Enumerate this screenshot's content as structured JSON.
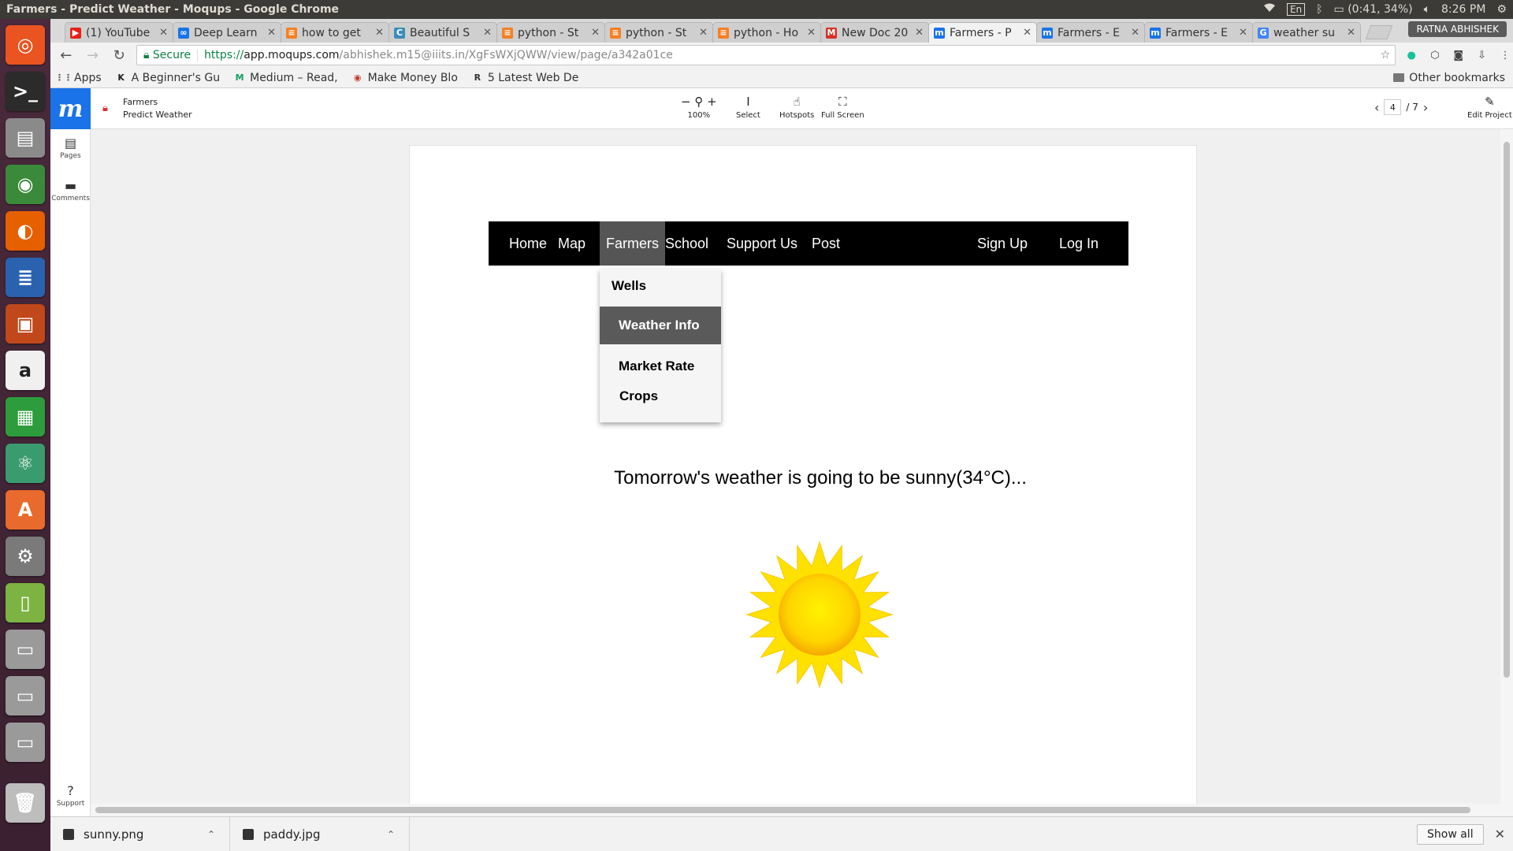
{
  "system_panel": {
    "window_title": "Farmers - Predict Weather - Moqups - Google Chrome",
    "keyboard": "En",
    "battery": "(0:41, 34%)",
    "clock": "8:26 PM"
  },
  "launcher": {
    "apps": [
      {
        "name": "ubuntu-dash-icon",
        "glyph": "◎",
        "color": "#e95420"
      },
      {
        "name": "terminal-icon",
        "glyph": ">_",
        "color": "#2b2b2b"
      },
      {
        "name": "file-manager-icon",
        "glyph": "▤",
        "color": "#8a8a8a"
      },
      {
        "name": "chrome-icon",
        "glyph": "◉",
        "color": "#3b8a3b"
      },
      {
        "name": "firefox-icon",
        "glyph": "◐",
        "color": "#e66000"
      },
      {
        "name": "writer-icon",
        "glyph": "≣",
        "color": "#2a62b0"
      },
      {
        "name": "impress-icon",
        "glyph": "▣",
        "color": "#c0481b"
      },
      {
        "name": "amazon-icon",
        "glyph": "a",
        "color": "#f0f0f0"
      },
      {
        "name": "calc-icon",
        "glyph": "▦",
        "color": "#2d9c3c"
      },
      {
        "name": "atom-icon",
        "glyph": "⚛",
        "color": "#3a9b6e"
      },
      {
        "name": "software-center-icon",
        "glyph": "A",
        "color": "#e86a2c"
      },
      {
        "name": "system-settings-icon",
        "glyph": "⚙",
        "color": "#7a7a7a"
      },
      {
        "name": "android-icon",
        "glyph": "▯",
        "color": "#7cb342"
      },
      {
        "name": "drive-1-icon",
        "glyph": "▭",
        "color": "#9a9a9a"
      },
      {
        "name": "drive-2-icon",
        "glyph": "▭",
        "color": "#9a9a9a"
      },
      {
        "name": "drive-3-icon",
        "glyph": "▭",
        "color": "#9a9a9a"
      },
      {
        "name": "trash-icon",
        "glyph": "🗑",
        "color": "#bdbdbd"
      }
    ]
  },
  "browser": {
    "tabs": [
      {
        "title": "(1) YouTube",
        "fav": "▶",
        "fav_color": "#e62117",
        "active": false
      },
      {
        "title": "Deep Learn",
        "fav": "∞",
        "fav_color": "#1a73e8",
        "active": false
      },
      {
        "title": "how to get",
        "fav": "≡",
        "fav_color": "#f48024",
        "active": false
      },
      {
        "title": "Beautiful S",
        "fav": "C",
        "fav_color": "#3c8dbc",
        "active": false
      },
      {
        "title": "python - St",
        "fav": "≡",
        "fav_color": "#f48024",
        "active": false
      },
      {
        "title": "python - St",
        "fav": "≡",
        "fav_color": "#f48024",
        "active": false
      },
      {
        "title": "python - Ho",
        "fav": "≡",
        "fav_color": "#f48024",
        "active": false
      },
      {
        "title": "New Doc 20",
        "fav": "M",
        "fav_color": "#d93025",
        "active": false
      },
      {
        "title": "Farmers - P",
        "fav": "m",
        "fav_color": "#1a73e8",
        "active": true
      },
      {
        "title": "Farmers - E",
        "fav": "m",
        "fav_color": "#1a73e8",
        "active": false
      },
      {
        "title": "Farmers - E",
        "fav": "m",
        "fav_color": "#1a73e8",
        "active": false
      },
      {
        "title": "weather su",
        "fav": "G",
        "fav_color": "#4285f4",
        "active": false
      }
    ],
    "profile": "RATNA ABHISHEK",
    "secure_label": "Secure",
    "url_scheme": "https://",
    "url_host": "app.moqups.com",
    "url_path": "/abhishek.m15@iiits.in/XgFsWXjQWW/view/page/a342a01ce",
    "bookmarks": [
      {
        "label": "Apps",
        "icon": "⋮⋮",
        "color": "#555"
      },
      {
        "label": "A Beginner's Gu",
        "icon": "K",
        "color": "#222"
      },
      {
        "label": "Medium – Read, ",
        "icon": "M",
        "color": "#12a05c"
      },
      {
        "label": "Make Money Blo",
        "icon": "◉",
        "color": "#c0392b"
      },
      {
        "label": "5 Latest Web De",
        "icon": "R",
        "color": "#333"
      }
    ],
    "other_bookmarks": "Other bookmarks"
  },
  "moqups": {
    "project_name": "Farmers",
    "page_name": "Predict Weather",
    "zoom": "100%",
    "tools": {
      "select": "Select",
      "hotspots": "Hotspots",
      "fullscreen": "Full Screen",
      "edit": "Edit Project"
    },
    "page_current": "4",
    "page_total": "/ 7",
    "sidebar": {
      "pages": "Pages",
      "comments": "Comments",
      "support": "Support"
    }
  },
  "mockup": {
    "nav": {
      "home": "Home",
      "map": "Map",
      "farmers": "Farmers",
      "school": "School",
      "support": "Support Us",
      "post": "Post",
      "signup": "Sign Up",
      "login": "Log In"
    },
    "dropdown": {
      "wells": "Wells",
      "weather": "Weather Info",
      "market": "Market Rate",
      "crops": "Crops"
    },
    "forecast": "Tomorrow's weather is going to be sunny(34°C)..."
  },
  "downloads": {
    "items": [
      {
        "file": "sunny.png"
      },
      {
        "file": "paddy.jpg"
      }
    ],
    "show_all": "Show all"
  }
}
